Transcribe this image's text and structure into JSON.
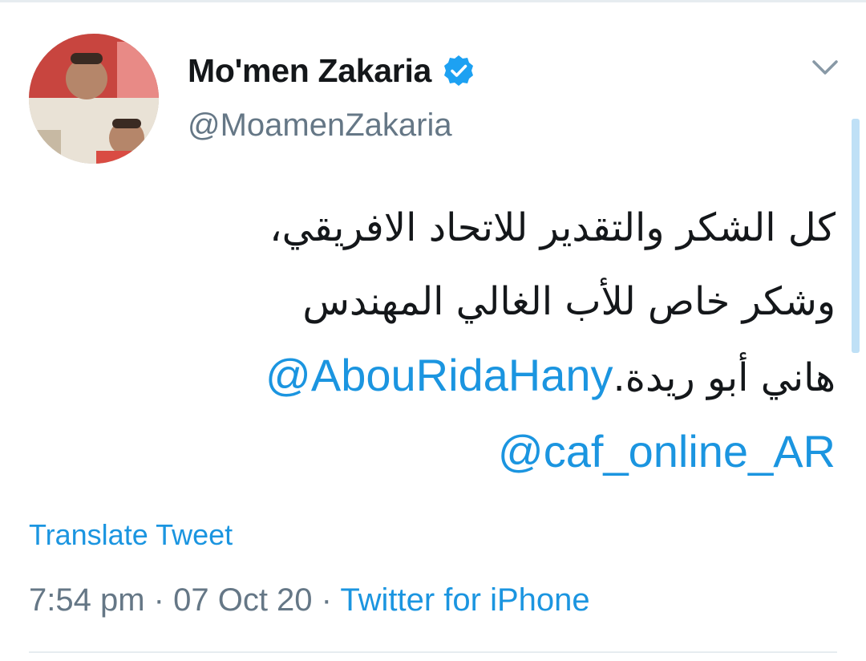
{
  "user": {
    "display_name": "Mo'men Zakaria",
    "handle": "@MoamenZakaria",
    "verified": true,
    "avatar_icon": "profile-photo"
  },
  "tweet": {
    "lines": [
      "كل الشكر والتقدير للاتحاد الافريقي،",
      "وشكر خاص للأب الغالي المهندس",
      "هاني أبو ريدة."
    ],
    "mentions": [
      "@AbouRidaHany",
      "@caf_online_AR"
    ]
  },
  "actions": {
    "translate_label": "Translate Tweet",
    "menu_icon": "chevron-down-icon"
  },
  "meta": {
    "time": "7:54 pm",
    "separator": "·",
    "date": "07 Oct 20",
    "source": "Twitter for iPhone"
  },
  "colors": {
    "accent": "#1b95e0",
    "verified_badge": "#1da1f2",
    "secondary_text": "#657786",
    "primary_text": "#14171a",
    "divider": "#e6ecf0"
  }
}
